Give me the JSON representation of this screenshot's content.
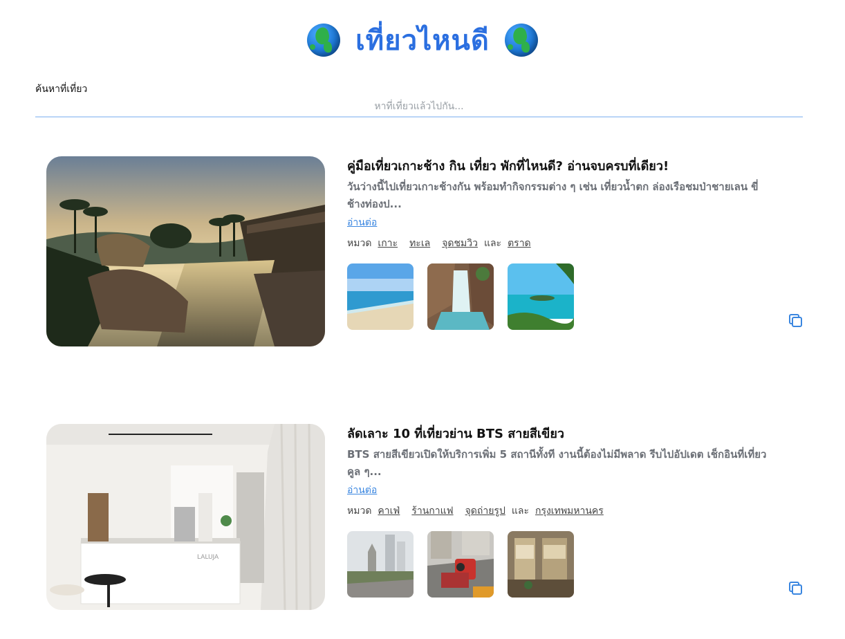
{
  "header": {
    "title": "เที่ยวไหนดี",
    "left_icon": "globe-icon",
    "right_icon": "globe-icon"
  },
  "search": {
    "label": "ค้นหาที่เที่ยว",
    "placeholder": "หาที่เที่ยวแล้วไปกัน...",
    "value": ""
  },
  "trips": [
    {
      "title": "คู่มือเที่ยวเกาะช้าง กิน เที่ยว พักที่ไหนดี? อ่านจบครบที่เดียว!",
      "description": "วันว่างนี้ไปเที่ยวเกาะช้างกัน พร้อมทำกิจกรรมต่าง ๆ เช่น เที่ยวน้ำตก ล่องเรือชมป่าชายเลน ขี่ช้างท่องป...",
      "read_more": "อ่านต่อ",
      "category_label": "หมวด",
      "categories": [
        "เกาะ",
        "ทะเล",
        "จุดชมวิว"
      ],
      "joiner": "และ",
      "last_category": "ตราด",
      "copy_icon": "copy-icon"
    },
    {
      "title": "ลัดเลาะ 10 ที่เที่ยวย่าน BTS สายสีเขียว",
      "description": "BTS สายสีเขียวเปิดให้บริการเพิ่ม 5 สถานีทั้งที งานนี้ต้องไม่มีพลาด รีบไปอัปเดต เช็กอินที่เที่ยวคูล ๆ...",
      "read_more": "อ่านต่อ",
      "category_label": "หมวด",
      "categories": [
        "คาเฟ่",
        "ร้านกาแฟ",
        "จุดถ่ายรูป"
      ],
      "joiner": "และ",
      "last_category": "กรุงเทพมหานคร",
      "copy_icon": "copy-icon"
    }
  ],
  "colors": {
    "title": "#2b6fe0",
    "link": "#3a86e0",
    "search_underline": "#b9d4f7",
    "description": "#6b6f76"
  }
}
